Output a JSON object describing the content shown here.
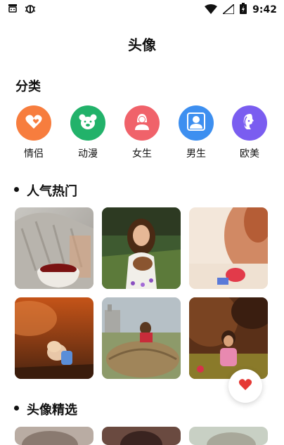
{
  "status_bar": {
    "time": "9:42"
  },
  "header": {
    "title": "头像"
  },
  "categories_section": {
    "heading": "分类",
    "items": [
      {
        "label": "情侣",
        "color": "#f77d3e",
        "icon": "heart-icon"
      },
      {
        "label": "动漫",
        "color": "#22b26a",
        "icon": "bear-icon"
      },
      {
        "label": "女生",
        "color": "#f0626a",
        "icon": "girl-icon"
      },
      {
        "label": "男生",
        "color": "#3d8ff0",
        "icon": "boy-icon"
      },
      {
        "label": "欧美",
        "color": "#7a5df0",
        "icon": "woman-profile-icon"
      }
    ]
  },
  "popular_section": {
    "heading": "人气热门",
    "images": [
      "sweater-with-coffee-cup",
      "girl-in-field-with-flowers",
      "blurred-child-with-toy",
      "child-on-sandy-ground-at-sunset",
      "child-on-hay-bale",
      "toddler-in-meadow"
    ]
  },
  "featured_section": {
    "heading": "头像精选"
  },
  "colors": {
    "fab_heart": "#e53935"
  }
}
